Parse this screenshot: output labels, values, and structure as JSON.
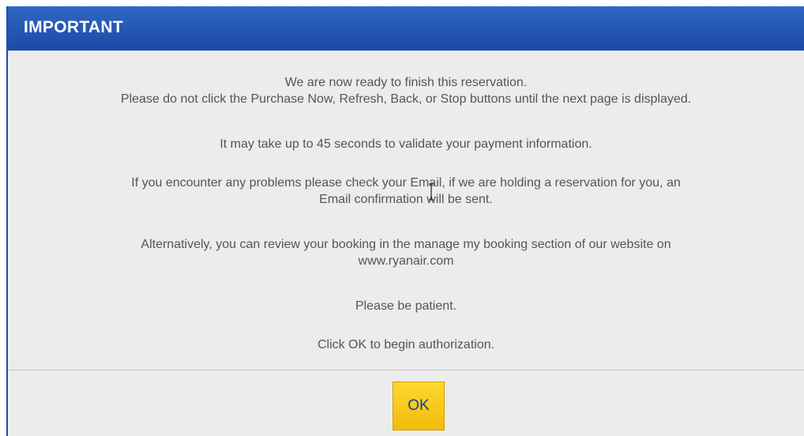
{
  "dialog": {
    "title": "IMPORTANT",
    "messages": {
      "line1": "We are now ready to finish this reservation.",
      "line2": "Please do not click the Purchase Now, Refresh, Back, or Stop buttons until the next page is displayed.",
      "validate": "It may take up to 45 seconds to validate your payment information.",
      "problems_line1": "If you encounter any problems please check your Email, if we are holding a reservation for you, an",
      "problems_line2": "Email confirmation will be sent.",
      "alt_line1": "Alternatively, you can review your booking in the manage my booking section of our website on",
      "alt_line2": "www.ryanair.com",
      "patient": "Please be patient.",
      "click_ok": "Click OK to begin authorization."
    },
    "ok_label": "OK"
  },
  "colors": {
    "titlebar": "#1b4aa8",
    "button": "#f5c518",
    "text": "#555555"
  },
  "icons": {
    "cursor": "text-cursor-icon"
  }
}
